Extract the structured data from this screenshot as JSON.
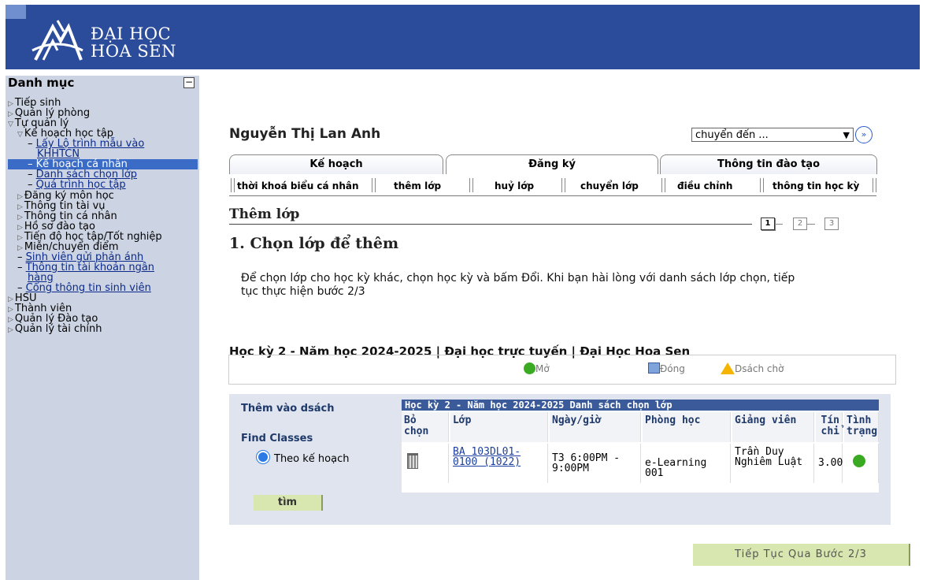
{
  "header": {
    "logo_line1": "ĐẠI HỌC",
    "logo_line2": "HOA SEN",
    "bg_color": "#2a4c9a"
  },
  "sidebar": {
    "title": "Danh mục",
    "collapse_icon": "minus-box-icon",
    "items": [
      {
        "label": "Tiếp sinh",
        "tri": "▷"
      },
      {
        "label": "Quản lý phòng",
        "tri": "▷"
      },
      {
        "label": "Tự quản lý",
        "tri": "▽"
      },
      {
        "label": "Kế hoạch học tập",
        "tri": "▽"
      },
      {
        "label": "Lấy Lộ trình mẫu vào",
        "link": true
      },
      {
        "label": "KHHTCN",
        "link": true
      },
      {
        "label": "Kế hoạch cá nhân",
        "selected": true
      },
      {
        "label": "Danh sách chọn lớp",
        "link": true
      },
      {
        "label": "Quá trình học tập",
        "link": true
      },
      {
        "label": "Đăng ký môn học",
        "tri": "▷"
      },
      {
        "label": "Thông tin tài vụ",
        "tri": "▷"
      },
      {
        "label": "Thông tin cá nhân",
        "tri": "▷"
      },
      {
        "label": "Hồ sơ đào tạo",
        "tri": "▷"
      },
      {
        "label": "Tiến độ học tập/Tốt nghiệp",
        "tri": "▷"
      },
      {
        "label": "Miễn/chuyển điểm",
        "tri": "▷"
      },
      {
        "label": "Sinh viên gửi phản ánh",
        "link": true
      },
      {
        "label": "Thông tin tài khoản ngân",
        "link": true
      },
      {
        "label": "hàng",
        "link": true
      },
      {
        "label": "Cổng thông tin sinh viên",
        "link": true
      },
      {
        "label": "HSU",
        "tri": "▷"
      },
      {
        "label": "Thành viên",
        "tri": "▷"
      },
      {
        "label": "Quản lý Đào tạo",
        "tri": "▷"
      },
      {
        "label": "Quản lý tài chính",
        "tri": "▷"
      }
    ]
  },
  "student_name": "Nguyễn Thị Lan Anh",
  "goto": {
    "selected": "chuyển đến ...",
    "go_icon": "double-chevron-right-icon"
  },
  "tabs": [
    {
      "label": "Kế hoạch"
    },
    {
      "label": "Đăng ký",
      "active": true
    },
    {
      "label": "Thông tin đào tạo"
    }
  ],
  "subtabs": [
    {
      "label": "thời khoá biểu cá nhân"
    },
    {
      "label": "thêm lớp",
      "active": true
    },
    {
      "label": "huỷ lớp"
    },
    {
      "label": "chuyển lớp"
    },
    {
      "label": "điều chỉnh"
    },
    {
      "label": "thông tin học kỳ"
    }
  ],
  "section_title": "Thêm lớp",
  "steps": [
    "1",
    "2",
    "3"
  ],
  "current_step": 1,
  "step_heading": "1. Chọn lớp để thêm",
  "instruction": "Để chọn lớp cho học kỳ khác, chọn học kỳ và bấm Đổi. Khi bạn hài lòng với danh sách lớp chọn, tiếp tục thực hiện bước 2/3",
  "term_line": "Học kỳ 2 - Năm học 2024-2025 | Đại học trực tuyến | Đại Học Hoa Sen",
  "legend": {
    "open": "Mở",
    "closed": "Đóng",
    "waitlist": "Dsách chờ"
  },
  "left_panel": {
    "add_label": "Thêm vào dsách",
    "find_label": "Find Classes",
    "radio_label": "Theo kế hoạch",
    "find_button": "tìm"
  },
  "cart": {
    "title": "Học kỳ 2 - Năm học 2024-2025 Danh sách chọn lớp",
    "headers": [
      "Bỏ chọn",
      "Lớp",
      "Ngày/giờ",
      "Phòng học",
      "Giảng viên",
      "Tín chỉ",
      "Tình trạng"
    ],
    "rows": [
      {
        "delete_icon": "trash-icon",
        "class": "BA 103DL01-0100 (1022)",
        "datetime": "T3 6:00PM - 9:00PM",
        "room": "e-Learning 001",
        "instructor": "Trần Duy Nghiêm Luật",
        "credits": "3.00",
        "status": "open"
      }
    ]
  },
  "next_button": "Tiếp Tục Qua Bước 2/3",
  "colors": {
    "accent": "#2a4c9a",
    "sidebar_bg": "#ccd4e3",
    "open_green": "#3aaa22",
    "button_bg": "#d8e6b0"
  }
}
